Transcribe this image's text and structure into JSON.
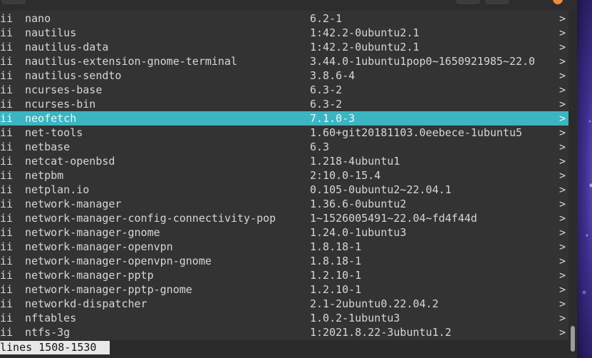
{
  "packages": [
    {
      "status": "ii",
      "name": "nano",
      "version": "6.2-1",
      "more": ">"
    },
    {
      "status": "ii",
      "name": "nautilus",
      "version": "1:42.2-0ubuntu2.1",
      "more": ">"
    },
    {
      "status": "ii",
      "name": "nautilus-data",
      "version": "1:42.2-0ubuntu2.1",
      "more": ">"
    },
    {
      "status": "ii",
      "name": "nautilus-extension-gnome-terminal",
      "version": "3.44.0-1ubuntu1pop0~1650921985~22.0",
      "more": ">"
    },
    {
      "status": "ii",
      "name": "nautilus-sendto",
      "version": "3.8.6-4",
      "more": ">"
    },
    {
      "status": "ii",
      "name": "ncurses-base",
      "version": "6.3-2",
      "more": ">"
    },
    {
      "status": "ii",
      "name": "ncurses-bin",
      "version": "6.3-2",
      "more": ">"
    },
    {
      "status": "ii",
      "name": "neofetch",
      "version": "7.1.0-3",
      "more": ">"
    },
    {
      "status": "ii",
      "name": "net-tools",
      "version": "1.60+git20181103.0eebece-1ubuntu5",
      "more": ">"
    },
    {
      "status": "ii",
      "name": "netbase",
      "version": "6.3",
      "more": ">"
    },
    {
      "status": "ii",
      "name": "netcat-openbsd",
      "version": "1.218-4ubuntu1",
      "more": ">"
    },
    {
      "status": "ii",
      "name": "netpbm",
      "version": "2:10.0-15.4",
      "more": ">"
    },
    {
      "status": "ii",
      "name": "netplan.io",
      "version": "0.105-0ubuntu2~22.04.1",
      "more": ">"
    },
    {
      "status": "ii",
      "name": "network-manager",
      "version": "1.36.6-0ubuntu2",
      "more": ">"
    },
    {
      "status": "ii",
      "name": "network-manager-config-connectivity-pop",
      "version": "1~1526005491~22.04~fd4f44d",
      "more": ">"
    },
    {
      "status": "ii",
      "name": "network-manager-gnome",
      "version": "1.24.0-1ubuntu3",
      "more": ">"
    },
    {
      "status": "ii",
      "name": "network-manager-openvpn",
      "version": "1.8.18-1",
      "more": ">"
    },
    {
      "status": "ii",
      "name": "network-manager-openvpn-gnome",
      "version": "1.8.18-1",
      "more": ">"
    },
    {
      "status": "ii",
      "name": "network-manager-pptp",
      "version": "1.2.10-1",
      "more": ">"
    },
    {
      "status": "ii",
      "name": "network-manager-pptp-gnome",
      "version": "1.2.10-1",
      "more": ">"
    },
    {
      "status": "ii",
      "name": "networkd-dispatcher",
      "version": "2.1-2ubuntu0.22.04.2",
      "more": ">"
    },
    {
      "status": "ii",
      "name": "nftables",
      "version": "1.0.2-1ubuntu3",
      "more": ">"
    },
    {
      "status": "ii",
      "name": "ntfs-3g",
      "version": "1:2021.8.22-3ubuntu1.2",
      "more": ">"
    }
  ],
  "selected_index": 7,
  "status_bar": {
    "lines": "lines 1508-1530"
  },
  "colors": {
    "selection": "#3bb5c1",
    "background": "#333334",
    "text": "#d6d6d6",
    "status_bg": "#e8e8e8",
    "close_button": "#f08a3a"
  }
}
